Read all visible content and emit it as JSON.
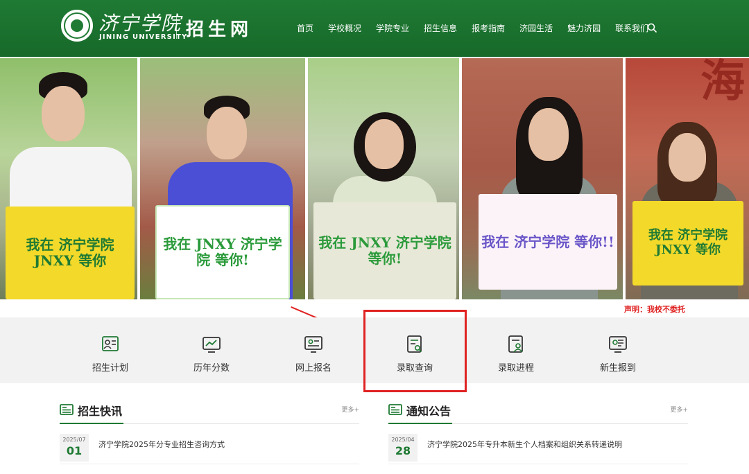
{
  "header": {
    "logo_cn": "济宁学院",
    "logo_en": "JINING UNIVERSITY",
    "site_name": "招生网",
    "nav": [
      "首页",
      "学校概况",
      "学院专业",
      "招生信息",
      "报考指南",
      "济园生活",
      "魅力济园",
      "联系我们"
    ],
    "search_icon": "search-icon"
  },
  "banner": {
    "signs": [
      {
        "text": "我在 济宁学院 JNXY 等你"
      },
      {
        "text": "我在 JNXY 济宁学院 等你!"
      },
      {
        "text": "我在 JNXY 济宁学院 等你!"
      },
      {
        "text": "我在 济宁学院 等你!!"
      },
      {
        "text": "我在 济宁学院 JNXY 等你"
      }
    ],
    "wall_char": "海"
  },
  "disclaimer": "声明：我校不委托",
  "quick_links": [
    {
      "label": "招生计划",
      "icon": "admission-plan-icon"
    },
    {
      "label": "历年分数",
      "icon": "score-chart-icon"
    },
    {
      "label": "网上报名",
      "icon": "online-signup-icon"
    },
    {
      "label": "录取查询",
      "icon": "admission-query-icon"
    },
    {
      "label": "录取进程",
      "icon": "admission-progress-icon"
    },
    {
      "label": "新生报到",
      "icon": "freshman-checkin-icon"
    }
  ],
  "news": {
    "title": "招生快讯",
    "more": "更多+",
    "items": [
      {
        "ym": "2025/07",
        "day": "01",
        "text": "济宁学院2025年分专业招生咨询方式"
      }
    ]
  },
  "notices": {
    "title": "通知公告",
    "more": "更多+",
    "items": [
      {
        "ym": "2025/04",
        "day": "28",
        "text": "济宁学院2025年专升本新生个人档案和组织关系转递说明"
      }
    ]
  },
  "colors": {
    "brand_green": "#1f7a33",
    "highlight_red": "#e02222"
  }
}
